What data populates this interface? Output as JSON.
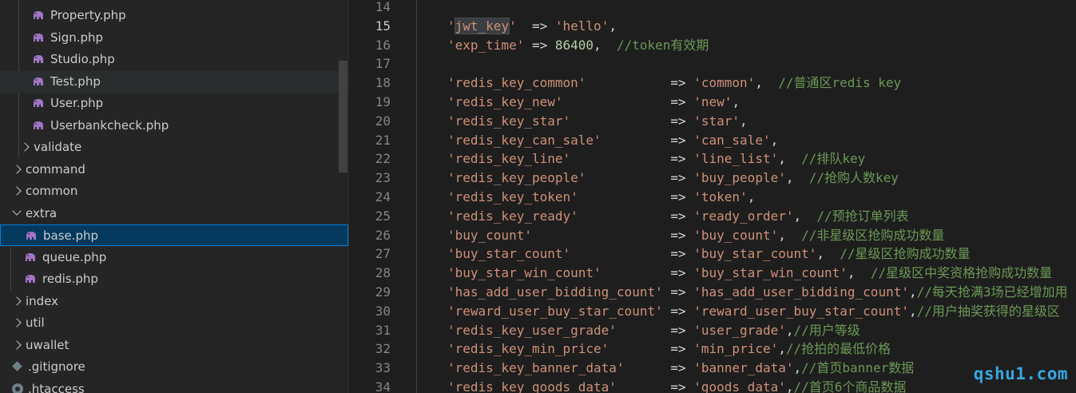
{
  "sidebar": {
    "items": [
      {
        "label": "Property.php",
        "kind": "php",
        "depth": 2
      },
      {
        "label": "Sign.php",
        "kind": "php",
        "depth": 2
      },
      {
        "label": "Studio.php",
        "kind": "php",
        "depth": 2
      },
      {
        "label": "Test.php",
        "kind": "php",
        "depth": 2,
        "state": "hover"
      },
      {
        "label": "User.php",
        "kind": "php",
        "depth": 2
      },
      {
        "label": "Userbankcheck.php",
        "kind": "php",
        "depth": 2
      },
      {
        "label": "validate",
        "kind": "folder-closed",
        "depth": 1
      },
      {
        "label": "command",
        "kind": "folder-closed",
        "depth": 0
      },
      {
        "label": "common",
        "kind": "folder-closed",
        "depth": 0
      },
      {
        "label": "extra",
        "kind": "folder-open",
        "depth": 0
      },
      {
        "label": "base.php",
        "kind": "php",
        "depth": 1,
        "state": "selected"
      },
      {
        "label": "queue.php",
        "kind": "php",
        "depth": 1
      },
      {
        "label": "redis.php",
        "kind": "php",
        "depth": 1
      },
      {
        "label": "index",
        "kind": "folder-closed",
        "depth": 0
      },
      {
        "label": "util",
        "kind": "folder-closed",
        "depth": 0
      },
      {
        "label": "uwallet",
        "kind": "folder-closed",
        "depth": 0
      },
      {
        "label": ".gitignore",
        "kind": "git",
        "depth": 0
      },
      {
        "label": ".htaccess",
        "kind": "gear",
        "depth": 0
      }
    ]
  },
  "editor": {
    "active_line": 15,
    "lines": [
      {
        "num": "14",
        "tokens": []
      },
      {
        "num": "15",
        "tokens": [
          [
            "str",
            "'"
          ],
          [
            "str-hl",
            "jwt_key"
          ],
          [
            "str",
            "'"
          ],
          [
            "op",
            "  => "
          ],
          [
            "str",
            "'hello'"
          ],
          [
            "op",
            ","
          ]
        ]
      },
      {
        "num": "16",
        "tokens": [
          [
            "str",
            "'exp_time'"
          ],
          [
            "op",
            " => "
          ],
          [
            "num",
            "86400"
          ],
          [
            "op",
            ",  "
          ],
          [
            "cmt",
            "//token有效期"
          ]
        ]
      },
      {
        "num": "17",
        "tokens": []
      },
      {
        "num": "18",
        "tokens": [
          [
            "str",
            "'redis_key_common'"
          ],
          [
            "op",
            "           => "
          ],
          [
            "str",
            "'common'"
          ],
          [
            "op",
            ",  "
          ],
          [
            "cmt",
            "//普通区redis key"
          ]
        ]
      },
      {
        "num": "19",
        "tokens": [
          [
            "str",
            "'redis_key_new'"
          ],
          [
            "op",
            "              => "
          ],
          [
            "str",
            "'new'"
          ],
          [
            "op",
            ","
          ]
        ]
      },
      {
        "num": "20",
        "tokens": [
          [
            "str",
            "'redis_key_star'"
          ],
          [
            "op",
            "             => "
          ],
          [
            "str",
            "'star'"
          ],
          [
            "op",
            ","
          ]
        ]
      },
      {
        "num": "21",
        "tokens": [
          [
            "str",
            "'redis_key_can_sale'"
          ],
          [
            "op",
            "         => "
          ],
          [
            "str",
            "'can_sale'"
          ],
          [
            "op",
            ","
          ]
        ]
      },
      {
        "num": "22",
        "tokens": [
          [
            "str",
            "'redis_key_line'"
          ],
          [
            "op",
            "             => "
          ],
          [
            "str",
            "'line_list'"
          ],
          [
            "op",
            ",  "
          ],
          [
            "cmt",
            "//排队key"
          ]
        ]
      },
      {
        "num": "23",
        "tokens": [
          [
            "str",
            "'redis_key_people'"
          ],
          [
            "op",
            "           => "
          ],
          [
            "str",
            "'buy_people'"
          ],
          [
            "op",
            ",  "
          ],
          [
            "cmt",
            "//抢购人数key"
          ]
        ]
      },
      {
        "num": "24",
        "tokens": [
          [
            "str",
            "'redis_key_token'"
          ],
          [
            "op",
            "            => "
          ],
          [
            "str",
            "'token'"
          ],
          [
            "op",
            ","
          ]
        ]
      },
      {
        "num": "25",
        "tokens": [
          [
            "str",
            "'redis_key_ready'"
          ],
          [
            "op",
            "            => "
          ],
          [
            "str",
            "'ready_order'"
          ],
          [
            "op",
            ",  "
          ],
          [
            "cmt",
            "//预抢订单列表"
          ]
        ]
      },
      {
        "num": "26",
        "tokens": [
          [
            "str",
            "'buy_count'"
          ],
          [
            "op",
            "                  => "
          ],
          [
            "str",
            "'buy_count'"
          ],
          [
            "op",
            ",  "
          ],
          [
            "cmt",
            "//非星级区抢购成功数量"
          ]
        ]
      },
      {
        "num": "27",
        "tokens": [
          [
            "str",
            "'buy_star_count'"
          ],
          [
            "op",
            "             => "
          ],
          [
            "str",
            "'buy_star_count'"
          ],
          [
            "op",
            ",  "
          ],
          [
            "cmt",
            "//星级区抢购成功数量"
          ]
        ]
      },
      {
        "num": "28",
        "tokens": [
          [
            "str",
            "'buy_star_win_count'"
          ],
          [
            "op",
            "         => "
          ],
          [
            "str",
            "'buy_star_win_count'"
          ],
          [
            "op",
            ",  "
          ],
          [
            "cmt",
            "//星级区中奖资格抢购成功数量"
          ]
        ]
      },
      {
        "num": "29",
        "tokens": [
          [
            "str",
            "'has_add_user_bidding_count'"
          ],
          [
            "op",
            " => "
          ],
          [
            "str",
            "'has_add_user_bidding_count'"
          ],
          [
            "op",
            ","
          ],
          [
            "cmt",
            "//每天抢满3场已经增加用"
          ]
        ]
      },
      {
        "num": "30",
        "tokens": [
          [
            "str",
            "'reward_user_buy_star_count'"
          ],
          [
            "op",
            " => "
          ],
          [
            "str",
            "'reward_user_buy_star_count'"
          ],
          [
            "op",
            ","
          ],
          [
            "cmt",
            "//用户抽奖获得的星级区"
          ]
        ]
      },
      {
        "num": "31",
        "tokens": [
          [
            "str",
            "'redis_key_user_grade'"
          ],
          [
            "op",
            "       => "
          ],
          [
            "str",
            "'user_grade'"
          ],
          [
            "op",
            ","
          ],
          [
            "cmt",
            "//用户等级"
          ]
        ]
      },
      {
        "num": "32",
        "tokens": [
          [
            "str",
            "'redis_key_min_price'"
          ],
          [
            "op",
            "        => "
          ],
          [
            "str",
            "'min_price'"
          ],
          [
            "op",
            ","
          ],
          [
            "cmt",
            "//抢拍的最低价格"
          ]
        ]
      },
      {
        "num": "33",
        "tokens": [
          [
            "str",
            "'redis_key_banner_data'"
          ],
          [
            "op",
            "      => "
          ],
          [
            "str",
            "'banner_data'"
          ],
          [
            "op",
            ","
          ],
          [
            "cmt",
            "//首页banner数据"
          ]
        ]
      },
      {
        "num": "34",
        "tokens": [
          [
            "str",
            "'redis_key_goods_data'"
          ],
          [
            "op",
            "       => "
          ],
          [
            "str",
            "'goods_data'"
          ],
          [
            "op",
            ","
          ],
          [
            "cmt",
            "//首页6个商品数据"
          ]
        ]
      }
    ]
  },
  "watermark": "qshu1.com",
  "colors": {
    "string": "#ce9178",
    "number": "#b5cea8",
    "comment": "#6a9955",
    "selection": "#04395e",
    "watermark": "#35a8e0"
  }
}
